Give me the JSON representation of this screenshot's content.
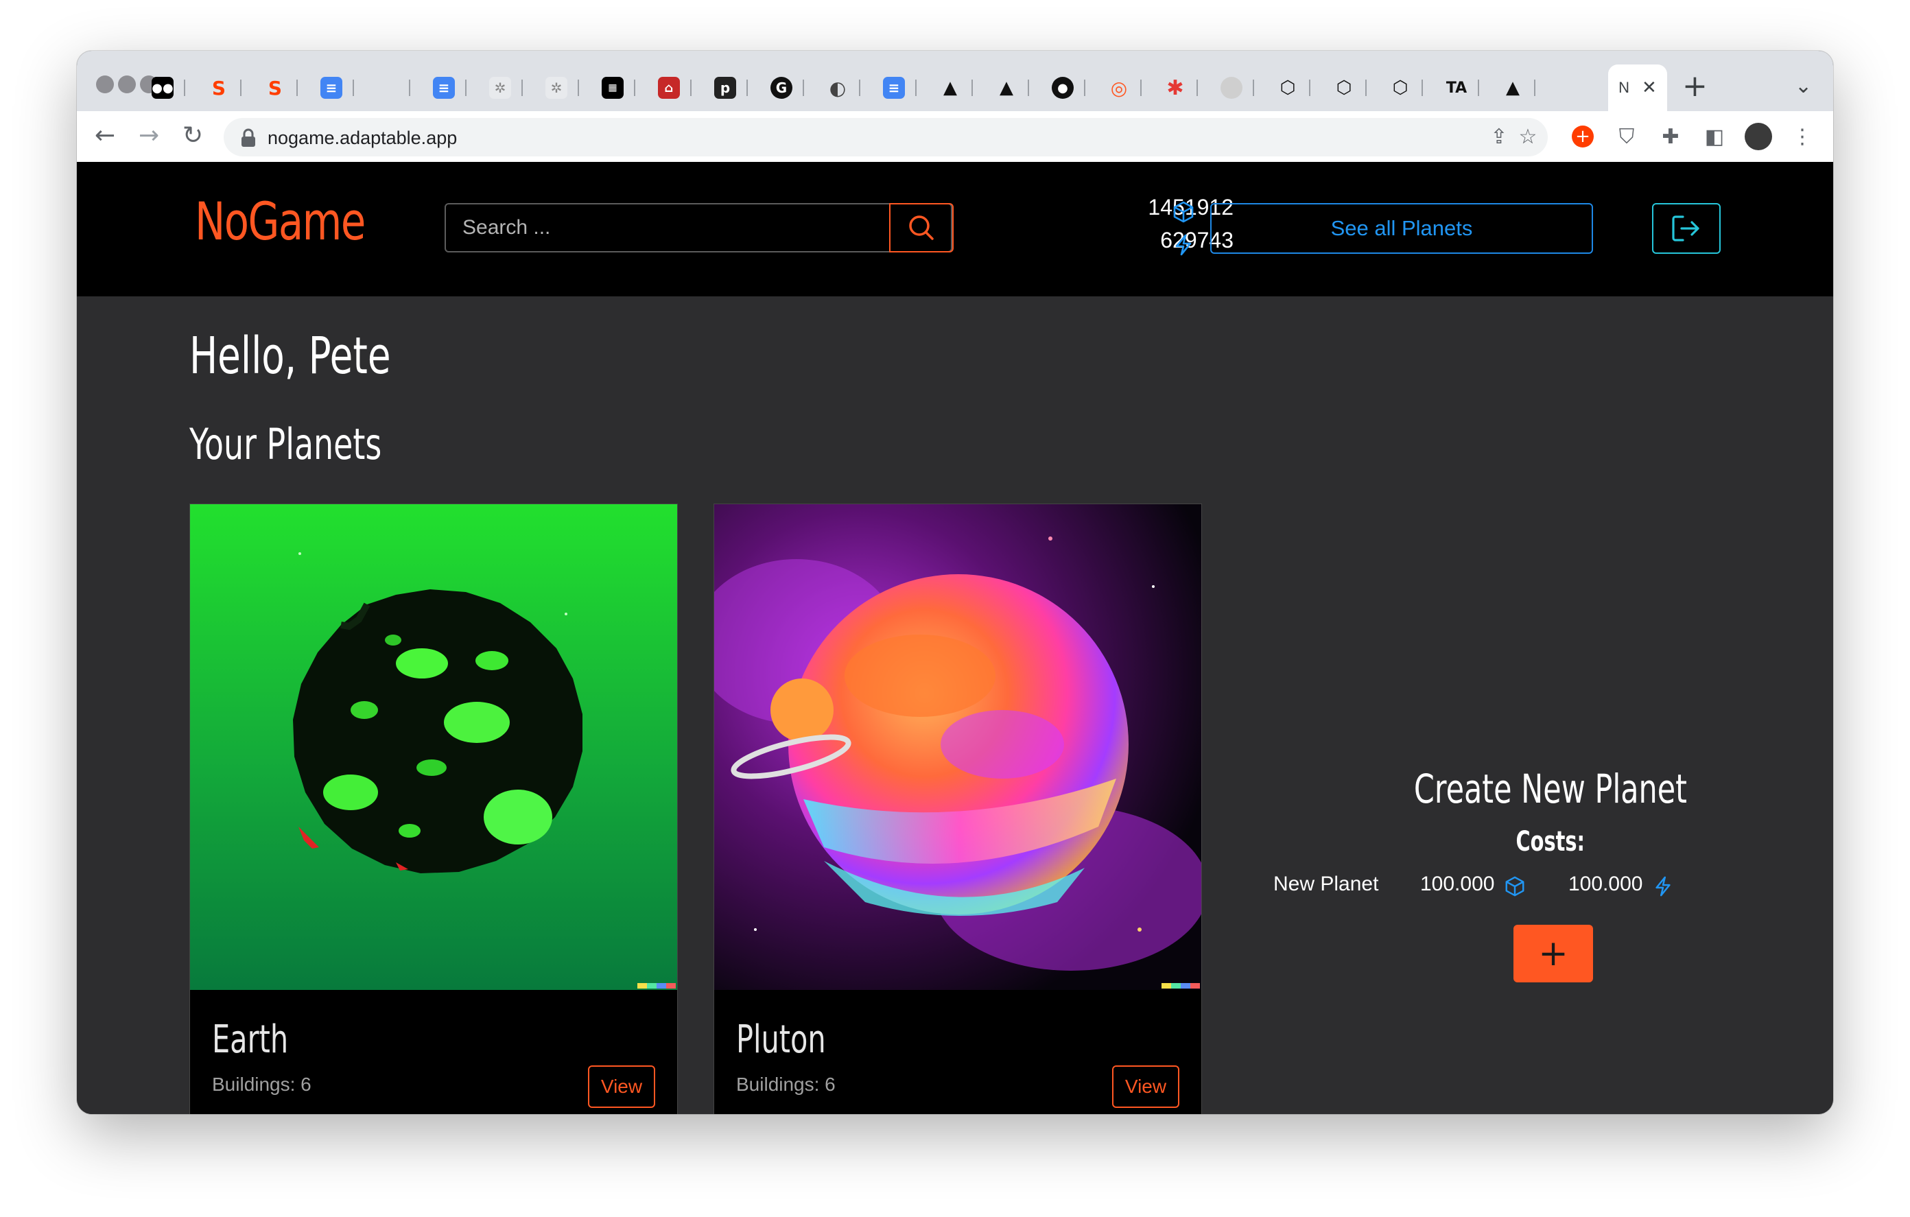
{
  "browser": {
    "url": "nogame.adaptable.app",
    "active_tab_label": "N",
    "new_tab_label": "+",
    "tab_menu_label": "⌄"
  },
  "app": {
    "brand": "NoGame",
    "search": {
      "placeholder": "Search ..."
    },
    "resources": {
      "cubes": "1451912",
      "energy": "629743"
    },
    "see_all_label": "See all Planets",
    "colors": {
      "accent": "#ff5722",
      "link": "#2196f3",
      "cyan": "#26c6da",
      "page_bg": "#2d2d2f",
      "nav_bg": "#000000"
    }
  },
  "main": {
    "greeting": "Hello, Pete",
    "section_title": "Your Planets",
    "planets": [
      {
        "name": "Earth",
        "buildings": "Buildings: 6",
        "view_label": "View"
      },
      {
        "name": "Pluton",
        "buildings": "Buildings: 6",
        "view_label": "View"
      }
    ],
    "create": {
      "title": "Create New Planet",
      "costs_label": "Costs:",
      "item": "New Planet",
      "cube_cost": "100.000",
      "energy_cost": "100.000",
      "add_label": "+"
    }
  }
}
